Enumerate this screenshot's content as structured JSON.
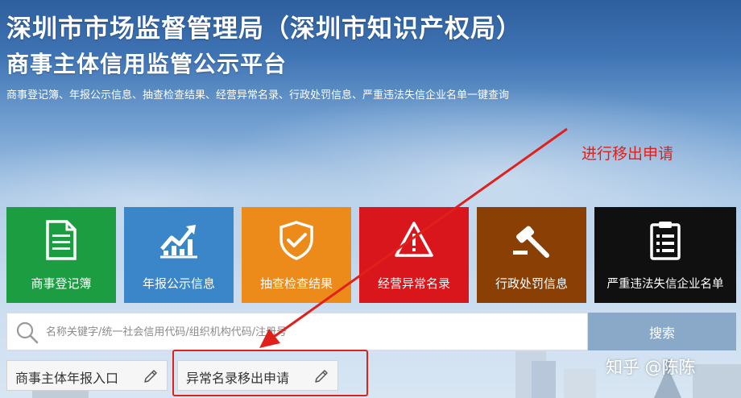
{
  "header": {
    "title_line1": "深圳市市场监督管理局（深圳市知识产权局）",
    "title_line2": "商事主体信用监管公示平台",
    "subtitle": "商事登记簿、年报公示信息、抽查检查结果、经营异常名录、行政处罚信息、严重违法失信企业名单一键查询"
  },
  "annotation": {
    "label": "进行移出申请",
    "color": "#e0201b"
  },
  "tiles": [
    {
      "label": "商事登记簿",
      "icon": "document-icon",
      "color": "#1d9d42"
    },
    {
      "label": "年报公示信息",
      "icon": "trend-chart-icon",
      "color": "#3a86c8"
    },
    {
      "label": "抽查检查结果",
      "icon": "shield-check-icon",
      "color": "#ec8a1a"
    },
    {
      "label": "经营异常名录",
      "icon": "warning-icon",
      "color": "#d8161b"
    },
    {
      "label": "行政处罚信息",
      "icon": "gavel-icon",
      "color": "#8a3f05"
    },
    {
      "label": "严重违法失信企业名单",
      "icon": "clipboard-icon",
      "color": "#101010"
    }
  ],
  "search": {
    "placeholder": "名称关键字/统一社会信用代码/组织机构代码/注册号",
    "value": "",
    "button_label": "搜索",
    "button_color": "#8aa8c8"
  },
  "links": {
    "annual_report": "商事主体年报入口",
    "abnormal_removal": "异常名录移出申请"
  },
  "watermark": "知乎 @陈陈"
}
